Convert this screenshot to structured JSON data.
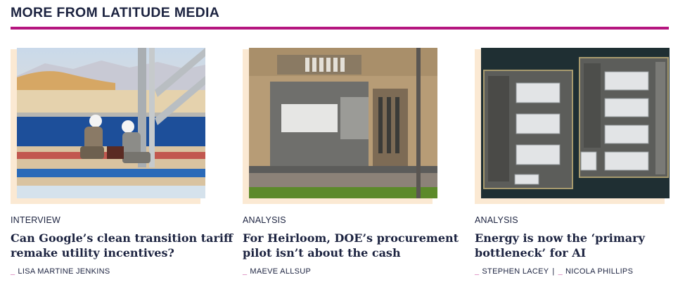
{
  "section": {
    "title": "MORE FROM LATITUDE MEDIA",
    "accent_color": "#b5157f",
    "shadow_color": "#fbe9d3"
  },
  "cards": [
    {
      "image_icon": "photo-workers-pipeline",
      "category": "INTERVIEW",
      "headline_lines": [
        "Can Google’s clean transition tariff",
        "remake utility incentives?"
      ],
      "authors": [
        "LISA MARTINE JENKINS"
      ]
    },
    {
      "image_icon": "photo-aerial-facility",
      "category": "ANALYSIS",
      "headline_lines": [
        "For Heirloom, DOE’s procurement",
        "pilot isn’t about the cash"
      ],
      "authors": [
        "MAEVE ALLSUP"
      ]
    },
    {
      "image_icon": "photo-aerial-datacenter",
      "category": "ANALYSIS",
      "headline_lines": [
        "Energy is now the ‘primary",
        "bottleneck’ for AI"
      ],
      "authors": [
        "STEPHEN LACEY",
        "NICOLA PHILLIPS"
      ],
      "author_separator": "|"
    }
  ]
}
